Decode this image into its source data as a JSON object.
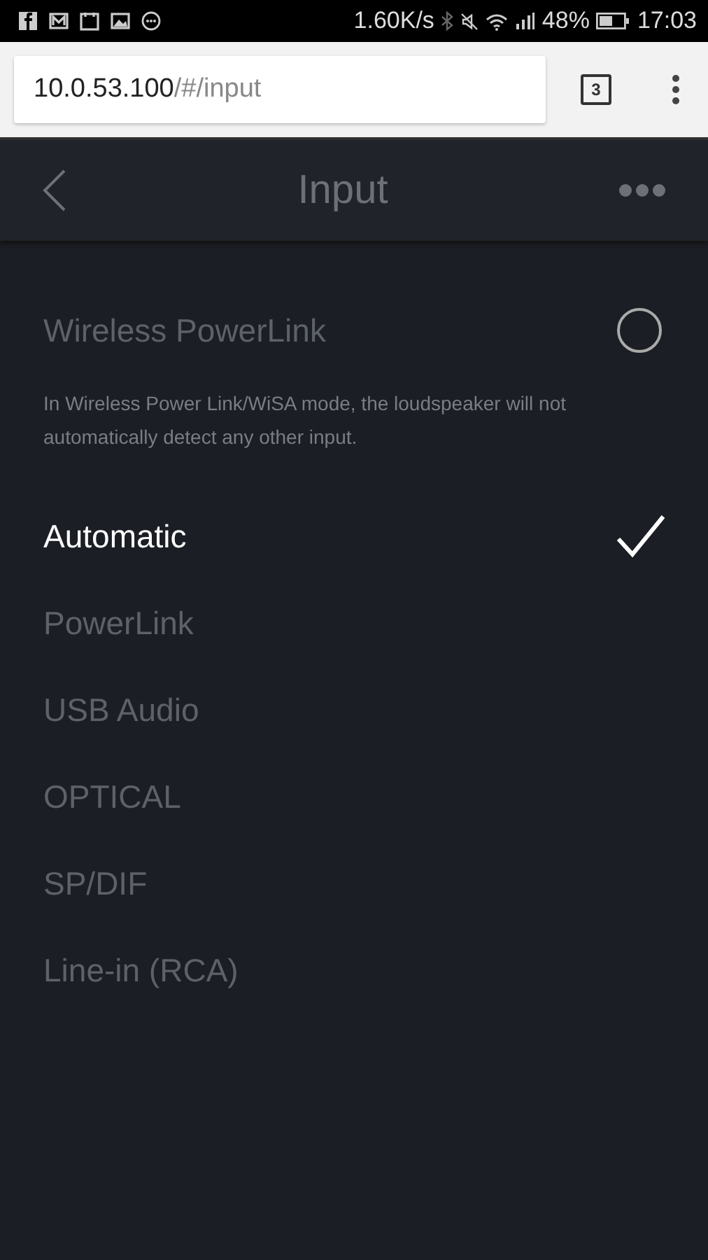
{
  "status_bar": {
    "speed": "1.60K/s",
    "battery": "48%",
    "time": "17:03"
  },
  "browser": {
    "url_host": "10.0.53.100",
    "url_path": "/#/input",
    "tab_count": "3"
  },
  "header": {
    "title": "Input"
  },
  "wireless": {
    "label": "Wireless PowerLink",
    "checked": false,
    "note": "In Wireless Power Link/WiSA mode, the loudspeaker will not automatically detect any other input."
  },
  "inputs": [
    {
      "label": "Automatic",
      "selected": true
    },
    {
      "label": "PowerLink",
      "selected": false
    },
    {
      "label": "USB Audio",
      "selected": false
    },
    {
      "label": "OPTICAL",
      "selected": false
    },
    {
      "label": "SP/DIF",
      "selected": false
    },
    {
      "label": "Line-in (RCA)",
      "selected": false
    }
  ]
}
